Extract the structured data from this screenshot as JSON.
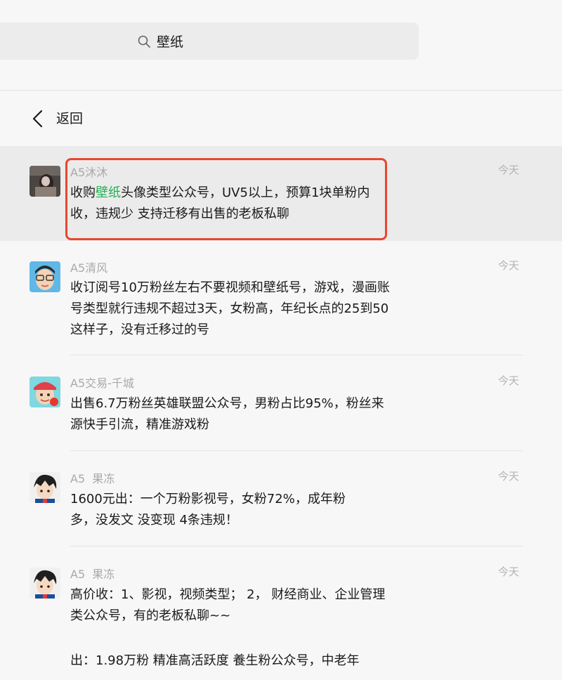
{
  "search": {
    "query": "壁纸"
  },
  "nav": {
    "back_label": "返回"
  },
  "messages": [
    {
      "sender": "A5沐沐",
      "time": "今天",
      "text_before": "收购",
      "text_highlight": "壁纸",
      "text_after": "头像类型公众号，UV5以上，预算1块单粉内收，违规少 支持迁移有出售的老板私聊",
      "selected": true
    },
    {
      "sender": "A5清风",
      "time": "今天",
      "text": "收订阅号10万粉丝左右不要视频和壁纸号，游戏，漫画账号类型就行违规不超过3天，女粉高，年纪长点的25到50这样子，没有迁移过的号"
    },
    {
      "sender": "A5交易-千城",
      "time": "今天",
      "text": "出售6.7万粉丝英雄联盟公众号，男粉占比95%，粉丝来源快手引流，精准游戏粉"
    },
    {
      "sender": "A5  果冻",
      "time": "今天",
      "text": "1600元出：一个万粉影视号，女粉72%，成年粉多，没发文 没变现  4条违规！"
    },
    {
      "sender": "A5  果冻",
      "time": "今天",
      "text_line1": "高价收：1、影视，视频类型； 2， 财经商业、企业管理类公众号，有的老板私聊~~",
      "text_line2": "出：1.98万粉 精准高活跃度 養生粉公众号，中老年"
    }
  ],
  "colors": {
    "highlight_green": "#23b04f",
    "annotation_red": "#e8472f"
  }
}
